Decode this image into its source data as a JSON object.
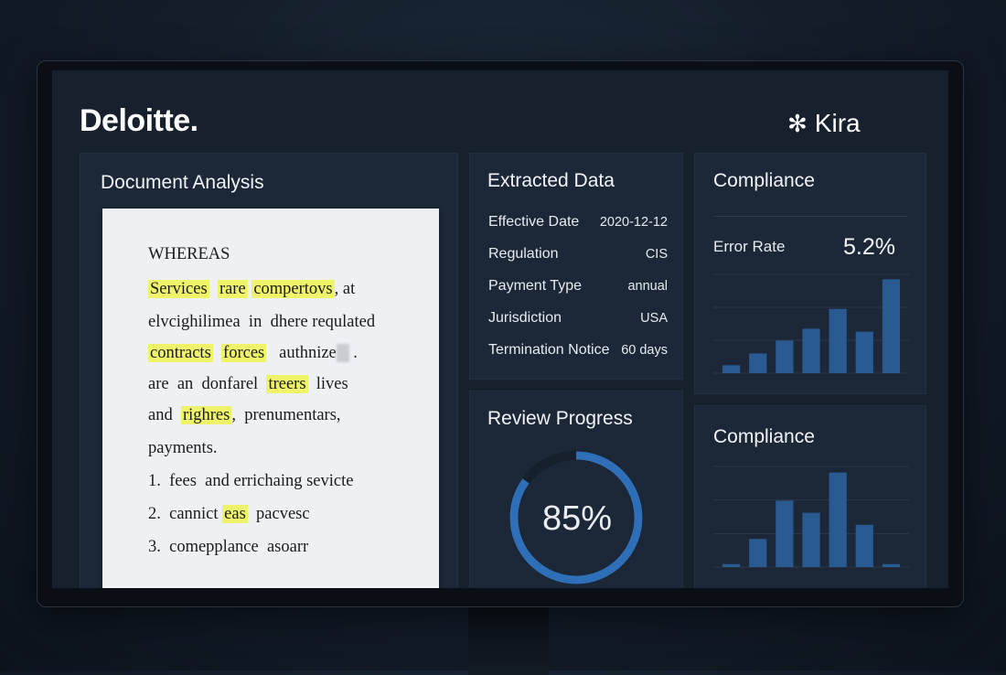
{
  "brand": {
    "left_logo": "Deloitte.",
    "right_logo": "Kira",
    "right_logo_icon": "asterisk-icon"
  },
  "document_analysis": {
    "title": "Document Analysis",
    "lines": [
      {
        "segments": [
          {
            "text": "WHEREAS",
            "hl": false
          }
        ]
      },
      {
        "segments": [
          {
            "text": "Services",
            "hl": true
          },
          {
            "text": "  ",
            "hl": false
          },
          {
            "text": "rare",
            "hl": true
          },
          {
            "text": " ",
            "hl": false
          },
          {
            "text": "compertovs",
            "hl": true
          },
          {
            "text": ", at",
            "hl": false
          }
        ]
      },
      {
        "segments": [
          {
            "text": "elvcighilimea  in  dhere requlated",
            "hl": false
          }
        ]
      },
      {
        "segments": [
          {
            "text": "contracts",
            "hl": true
          },
          {
            "text": "  ",
            "hl": false
          },
          {
            "text": "forces",
            "hl": true
          },
          {
            "text": "   authnize",
            "hl": false
          },
          {
            "text": "   ",
            "hl": false,
            "blur": true
          },
          {
            "text": " .",
            "hl": false
          }
        ]
      },
      {
        "segments": [
          {
            "text": "are  an  donfarel  ",
            "hl": false
          },
          {
            "text": "treers",
            "hl": true
          },
          {
            "text": "  lives",
            "hl": false
          }
        ]
      },
      {
        "segments": [
          {
            "text": "and  ",
            "hl": false
          },
          {
            "text": "righres",
            "hl": true
          },
          {
            "text": ",  prenumentars,",
            "hl": false
          }
        ]
      },
      {
        "segments": [
          {
            "text": "payments.",
            "hl": false
          }
        ]
      },
      {
        "segments": [
          {
            "text": "1.  fees  and errichaing sevicte",
            "hl": false
          }
        ]
      },
      {
        "segments": [
          {
            "text": "2.  cannict ",
            "hl": false
          },
          {
            "text": "eas",
            "hl": true
          },
          {
            "text": "  pacvesc",
            "hl": false
          }
        ]
      },
      {
        "segments": [
          {
            "text": "3.  comepplance  asoarr",
            "hl": false
          }
        ]
      }
    ]
  },
  "extracted_data": {
    "title": "Extracted Data",
    "rows": [
      {
        "label": "Effective Date",
        "value": "2020-12-12"
      },
      {
        "label": "Regulation",
        "value": "CIS"
      },
      {
        "label": "Payment Type",
        "value": "annual"
      },
      {
        "label": "Jurisdiction",
        "value": "USA"
      },
      {
        "label": "Termination Notice",
        "value": "60 days"
      }
    ]
  },
  "review_progress": {
    "title": "Review Progress",
    "percent_label": "85%",
    "percent": 85
  },
  "compliance_top": {
    "title": "Compliance",
    "metric_label": "Error Rate",
    "metric_value": "5.2%",
    "bars": [
      0.08,
      0.2,
      0.33,
      0.45,
      0.65,
      0.42,
      0.95
    ]
  },
  "compliance_bottom": {
    "title": "Compliance",
    "bars": [
      0.03,
      0.28,
      0.66,
      0.54,
      0.94,
      0.42,
      0.03
    ]
  },
  "colors": {
    "accent_ring": "#2e6fb7",
    "bar": "#2a5a92",
    "highlight": "#eef36a"
  }
}
